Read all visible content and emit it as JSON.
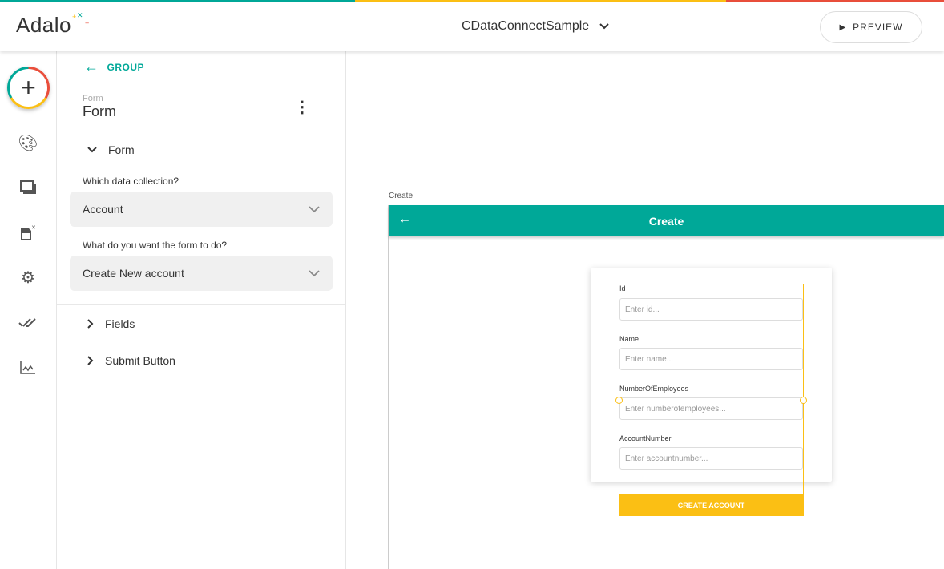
{
  "brand": {
    "name": "Adalo",
    "colors": {
      "teal": "#00a898",
      "yellow": "#fbbf14",
      "red": "#e94e3b"
    }
  },
  "header": {
    "app_name": "CDataConnectSample",
    "preview_label": "PREVIEW"
  },
  "panel": {
    "back_label": "GROUP",
    "component_type": "Form",
    "component_name": "Form",
    "form_section": "Form",
    "collection_label": "Which data collection?",
    "collection_value": "Account",
    "action_label": "What do you want the form to do?",
    "action_value": "Create New account",
    "sections": [
      "Fields",
      "Submit Button"
    ]
  },
  "canvas": {
    "screen_label": "Create",
    "screen_title": "Create",
    "fields": [
      {
        "label": "Id",
        "placeholder": "Enter id..."
      },
      {
        "label": "Name",
        "placeholder": "Enter name..."
      },
      {
        "label": "NumberOfEmployees",
        "placeholder": "Enter numberofemployees..."
      },
      {
        "label": "AccountNumber",
        "placeholder": "Enter accountnumber..."
      }
    ],
    "submit_label": "CREATE ACCOUNT"
  }
}
